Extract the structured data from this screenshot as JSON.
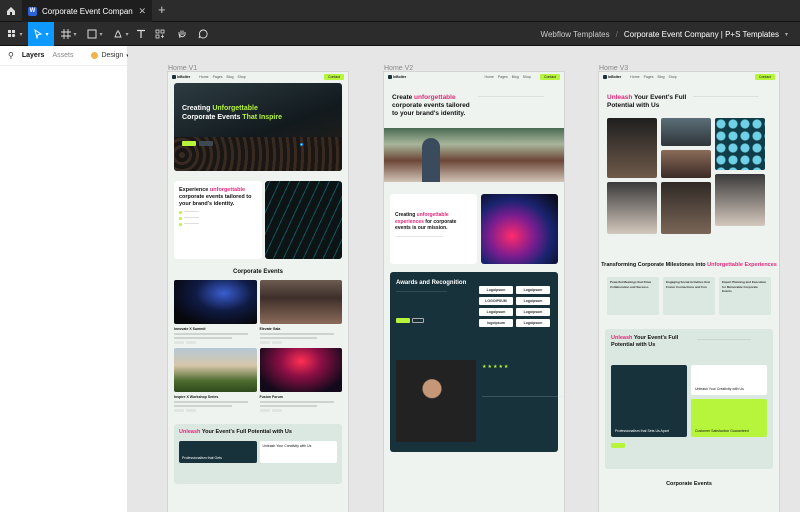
{
  "tab": {
    "title": "Corporate Event Company | P+S T",
    "favicon_letter": "W"
  },
  "toolbar": {
    "icons": [
      "figma-menu-icon",
      "move-tool-icon",
      "frame-tool-icon",
      "shape-tool-icon",
      "pen-tool-icon",
      "text-tool-icon",
      "component-icon",
      "hand-tool-icon",
      "comment-icon"
    ]
  },
  "breadcrumb": {
    "project": "Webflow Templates",
    "separator": "/",
    "file": "Corporate Event Company | P+S Templates"
  },
  "leftpanel": {
    "tab_layers": "Layers",
    "tab_assets": "Assets",
    "design_label": "Design"
  },
  "frames": [
    {
      "label": "Home V1"
    },
    {
      "label": "Home V2"
    },
    {
      "label": "Home V3"
    }
  ],
  "v1": {
    "brand": "InBolter",
    "nav_links": [
      "Home",
      "Pages",
      "Blog",
      "Shop"
    ],
    "nav_cta": "Contact",
    "hero_pre": "Creating ",
    "hero_hl1": "Unforgettable",
    "hero_mid": " Corporate Events ",
    "hero_hl2": "That Inspire",
    "sec2_pre": "Experience ",
    "sec2_hl": "unforgettable",
    "sec2_post": " corporate events tailored to your brand's identity.",
    "events_title": "Corporate Events",
    "cards": [
      {
        "title": "Innovate X Summit"
      },
      {
        "title": "Elevate Gala"
      },
      {
        "title": "Inspire X Workshop Series"
      },
      {
        "title": "Fusion Forum"
      }
    ],
    "unl_hl": "Unleash",
    "unl_post": " Your Event's Full Potential with Us",
    "dark_card": "Professionalism that Gets",
    "white_card": "Unleash Your Creativity with Us"
  },
  "v2": {
    "hero_pre": "Create ",
    "hero_hl": "unforgettable",
    "hero_post": " corporate events tailored to your brand's identity.",
    "mid_pre": "Creating ",
    "mid_hl": "unforgettable experiences",
    "mid_post": " for corporate events is our mission.",
    "award_title": "Awards and Recognition",
    "logos": [
      "Logoipsum",
      "Logoipsum",
      "LOGOIPSUM",
      "Logoipsum",
      "Logoipsum",
      "Logoipsum",
      "logoipsum",
      "Logoipsum"
    ],
    "stars": "★★★★★"
  },
  "v3": {
    "hero_hl": "Unleash",
    "hero_post": " Your Event's Full Potential with Us",
    "tm_pre": "Transforming Corporate Milestones into ",
    "tm_hl": "Unforgettable Experiences",
    "features": [
      "Powerful Meetings that Drive Collaboration and Success",
      "Engaging Social Activities that Foster Connections and Fun",
      "Expert Planning and Execution for Memorable Corporate Events"
    ],
    "unl_hl": "Unleash",
    "unl_post": " Your Event's Full Potential with Us",
    "dark_card": "Professionalism that Sets Us Apart",
    "white_card": "Unleash Your Creativity with Us",
    "green_card": "Customer Satisfaction Guaranteed",
    "events_title": "Corporate Events"
  }
}
